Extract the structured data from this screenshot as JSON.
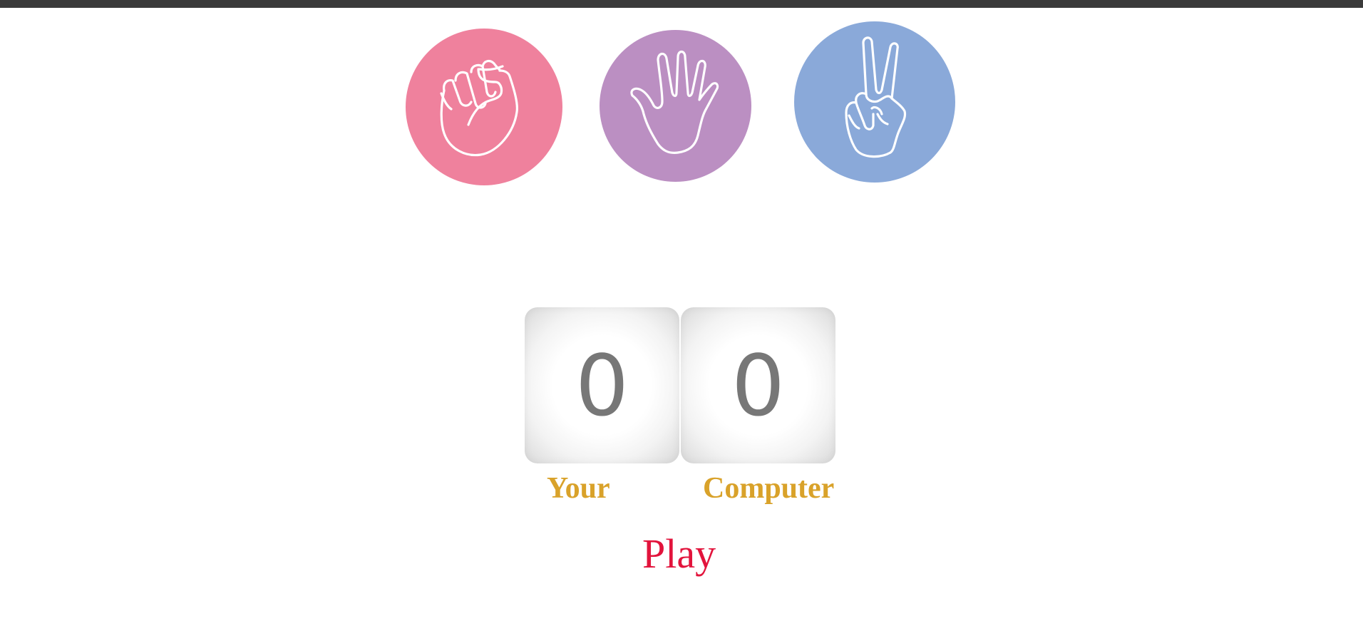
{
  "choices": [
    {
      "id": "rock",
      "icon": "fist-hand-icon",
      "color": "#ef819d"
    },
    {
      "id": "paper",
      "icon": "open-hand-icon",
      "color": "#bb8fc2"
    },
    {
      "id": "scissors",
      "icon": "peace-sign-hand-icon",
      "color": "#8aa9d9"
    }
  ],
  "scoreboard": {
    "user_score": "0",
    "computer_score": "0",
    "user_label": "Your",
    "computer_label": "Computer"
  },
  "play_button": {
    "label": "Play",
    "color": "#e2143c"
  },
  "colors": {
    "label_gold": "#d9a22a",
    "score_gray": "#777777",
    "top_bar": "#3a3a3a"
  }
}
